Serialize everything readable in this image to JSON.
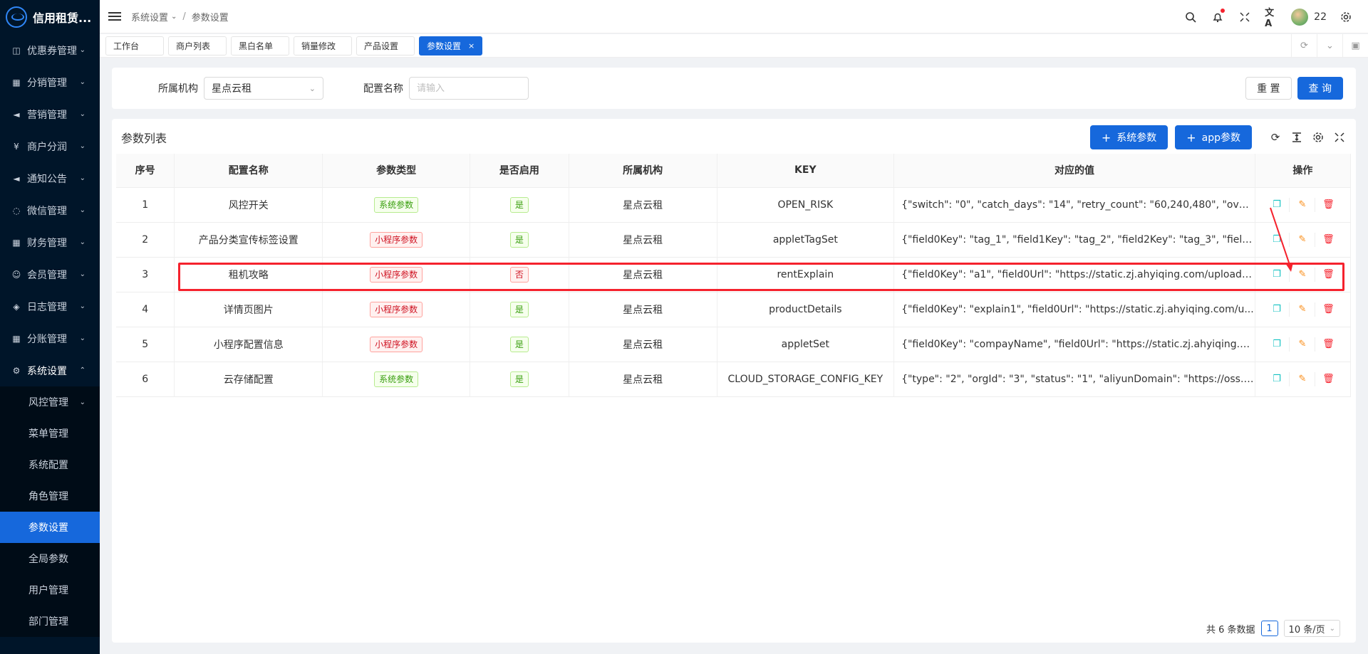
{
  "app": {
    "title": "信用租赁..."
  },
  "header": {
    "breadcrumb": [
      "系统设置",
      "参数设置"
    ],
    "user": "22"
  },
  "sidebar": {
    "items": [
      {
        "label": "优惠券管理"
      },
      {
        "label": "分销管理"
      },
      {
        "label": "营销管理"
      },
      {
        "label": "商户分润"
      },
      {
        "label": "通知公告"
      },
      {
        "label": "微信管理"
      },
      {
        "label": "财务管理"
      },
      {
        "label": "会员管理"
      },
      {
        "label": "日志管理"
      },
      {
        "label": "分账管理"
      },
      {
        "label": "系统设置"
      }
    ],
    "sub_items": [
      {
        "label": "风控管理"
      },
      {
        "label": "菜单管理"
      },
      {
        "label": "系统配置"
      },
      {
        "label": "角色管理"
      },
      {
        "label": "参数设置"
      },
      {
        "label": "全局参数"
      },
      {
        "label": "用户管理"
      },
      {
        "label": "部门管理"
      }
    ]
  },
  "tabs": [
    "工作台",
    "商户列表",
    "黑白名单",
    "销量修改",
    "产品设置",
    "参数设置"
  ],
  "search": {
    "org_label": "所属机构",
    "org_value": "星点云租",
    "name_label": "配置名称",
    "name_placeholder": "请输入",
    "reset": "重 置",
    "query": "查 询"
  },
  "list": {
    "title": "参数列表",
    "add_system": "系统参数",
    "add_app": "app参数",
    "columns": [
      "序号",
      "配置名称",
      "参数类型",
      "是否启用",
      "所属机构",
      "KEY",
      "对应的值",
      "操作"
    ],
    "rows": [
      {
        "no": "1",
        "name": "风控开关",
        "type": "系统参数",
        "enabled": "是",
        "org": "星点云租",
        "key": "OPEN_RISK",
        "value": "{\"switch\": \"0\", \"catch_days\": \"14\", \"retry_count\": \"60,240,480\", \"overd..."
      },
      {
        "no": "2",
        "name": "产品分类宣传标签设置",
        "type": "小程序参数",
        "enabled": "是",
        "org": "星点云租",
        "key": "appletTagSet",
        "value": "{\"field0Key\": \"tag_1\", \"field1Key\": \"tag_2\", \"field2Key\": \"tag_3\", \"field..."
      },
      {
        "no": "3",
        "name": "租机攻略",
        "type": "小程序参数",
        "enabled": "否",
        "org": "星点云租",
        "key": "rentExplain",
        "value": "{\"field0Key\": \"a1\", \"field0Url\": \"https://static.zj.ahyiqing.com/upload/..."
      },
      {
        "no": "4",
        "name": "详情页图片",
        "type": "小程序参数",
        "enabled": "是",
        "org": "星点云租",
        "key": "productDetails",
        "value": "{\"field0Key\": \"explain1\", \"field0Url\": \"https://static.zj.ahyiqing.com/u..."
      },
      {
        "no": "5",
        "name": "小程序配置信息",
        "type": "小程序参数",
        "enabled": "是",
        "org": "星点云租",
        "key": "appletSet",
        "value": "{\"field0Key\": \"compayName\", \"field0Url\": \"https://static.zj.ahyiqing.c..."
      },
      {
        "no": "6",
        "name": "云存储配置",
        "type": "系统参数",
        "enabled": "是",
        "org": "星点云租",
        "key": "CLOUD_STORAGE_CONFIG_KEY",
        "value": "{\"type\": \"2\", \"orgId\": \"3\", \"status\": \"1\", \"aliyunDomain\": \"https://oss.ja..."
      }
    ]
  },
  "pager": {
    "total": "共 6 条数据",
    "page": "1",
    "size": "10 条/页"
  },
  "colors": {
    "accent": "#1668dc",
    "sidebar": "#001529",
    "highlight": "#f5222d"
  }
}
